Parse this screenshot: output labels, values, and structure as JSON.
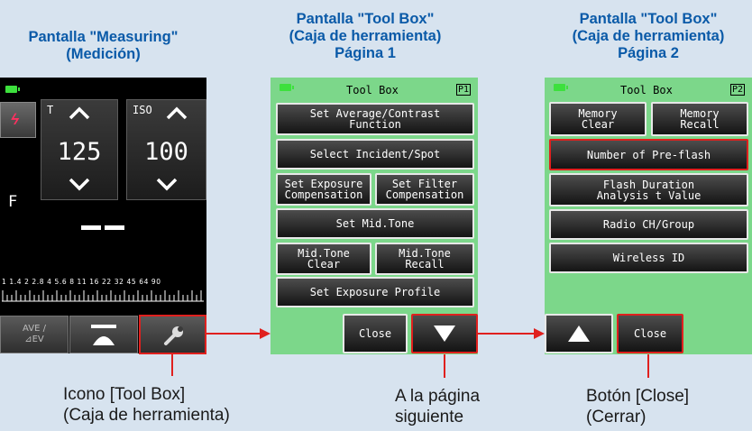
{
  "captions": {
    "measuring": {
      "line1": "Pantalla \"Measuring\"",
      "line2": "(Medición)"
    },
    "toolbox_p1": {
      "line1": "Pantalla \"Tool Box\"",
      "line2": "(Caja de herramienta)",
      "line3": "Página 1"
    },
    "toolbox_p2": {
      "line1": "Pantalla \"Tool Box\"",
      "line2": "(Caja de herramienta)",
      "line3": "Página 2"
    }
  },
  "measuring": {
    "t_label": "T",
    "t_value": "125",
    "iso_label": "ISO",
    "iso_value": "100",
    "f_label": "F",
    "scale": "1  1.4  2  2.8  4  5.6  8  11  16  22  32  45  64  90",
    "ave_label": "AVE /",
    "ev_label": "⊿EV",
    "icons": [
      "battery-icon",
      "flash-icon",
      "up-arrow-icon",
      "down-arrow-icon",
      "meter-icon",
      "wrench-icon"
    ]
  },
  "toolbox_page1": {
    "title": "Tool Box",
    "page": "P1",
    "buttons": [
      "Set Average/Contrast\nFunction",
      "Select Incident/Spot",
      "Set Exposure\nCompensation",
      "Set Filter\nCompensation",
      "Set Mid.Tone",
      "Mid.Tone\nClear",
      "Mid.Tone\nRecall",
      "Set Exposure Profile"
    ],
    "close": "Close"
  },
  "toolbox_page2": {
    "title": "Tool Box",
    "page": "P2",
    "buttons": [
      "Memory\nClear",
      "Memory\nRecall",
      "Number of Pre-flash",
      "Flash Duration\nAnalysis t Value",
      "Radio CH/Group",
      "Wireless ID"
    ],
    "close": "Close"
  },
  "annotations": {
    "toolbox_icon": {
      "line1": "Icono [Tool Box]",
      "line2": "(Caja de herramienta)"
    },
    "next_page": {
      "line1": "A la página",
      "line2": "siguiente"
    },
    "close_button": {
      "line1": "Botón [Close]",
      "line2": "(Cerrar)"
    }
  },
  "colors": {
    "caption": "#0a5aa8",
    "highlight": "#e0201e",
    "screen_bg": "#7cd78a",
    "page_bg": "#d7e3ef"
  }
}
